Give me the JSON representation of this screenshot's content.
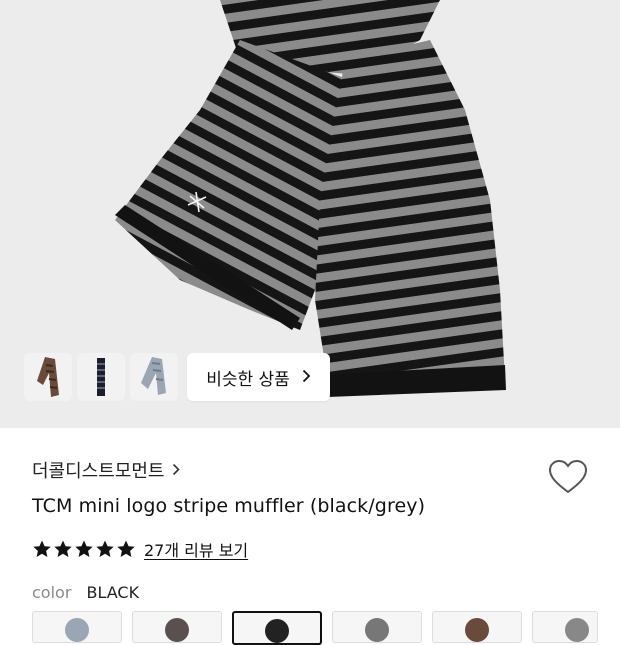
{
  "gallery": {
    "similar_button": {
      "label": "비슷한 상품",
      "chevron": "chevron-right-icon"
    },
    "thumbnails": [
      "brown-striped-scarf",
      "black-navy-striped-scarf",
      "grey-blue-scarf"
    ]
  },
  "product": {
    "brand": "더콜디스트모먼트",
    "brand_chevron": "chevron-right-icon",
    "title": "TCM mini logo stripe muffler (black/grey)",
    "rating": 5,
    "review_link": "27개 리뷰 보기",
    "color_label": "color",
    "color_value": "BLACK",
    "wishlist_icon": "heart-icon"
  },
  "colors": {
    "star": "#111111",
    "scarf_black": "#141414",
    "scarf_grey": "#8c8c8c",
    "hero_bg": "#ececec"
  }
}
